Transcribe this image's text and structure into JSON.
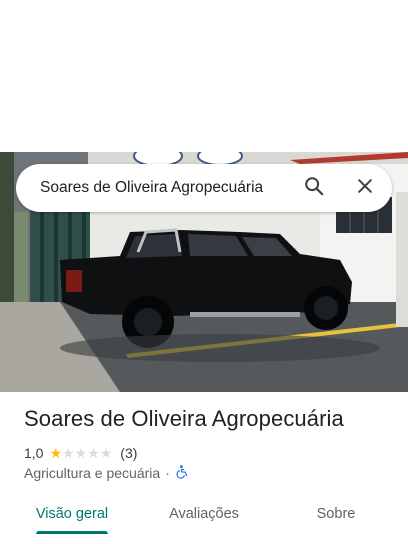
{
  "search": {
    "query": "Soares de Oliveira Agropecuária",
    "search_icon": "search-icon",
    "close_icon": "close-icon"
  },
  "place": {
    "name": "Soares de Oliveira Agropecuária",
    "rating": "1,0",
    "rating_stars": 1,
    "rating_max": 5,
    "review_count": "(3)",
    "category": "Agricultura e pecuária",
    "separator": "·",
    "accessibility_icon": "wheelchair-icon"
  },
  "tabs": [
    {
      "label": "Visão geral",
      "active": true
    },
    {
      "label": "Avaliações",
      "active": false
    },
    {
      "label": "Sobre",
      "active": false
    }
  ],
  "colors": {
    "accent": "#00796b",
    "star": "#fbbc04",
    "star_empty": "#dadce0",
    "accessibility": "#1a73e8"
  }
}
